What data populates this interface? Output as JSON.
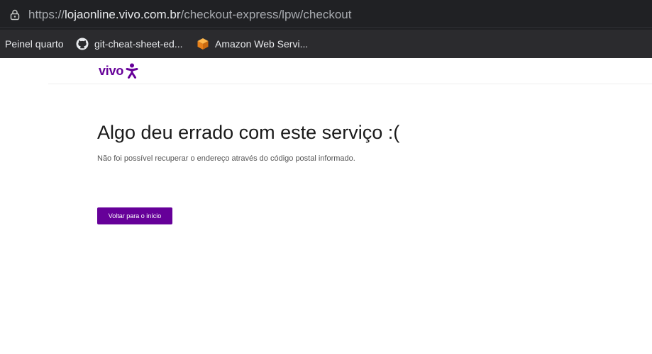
{
  "browser": {
    "url_scheme": "https://",
    "url_host": "lojaonline.vivo.com.br",
    "url_path": "/checkout-express/lpw/checkout",
    "bookmarks": [
      {
        "label": "Peinel quarto",
        "icon": "none"
      },
      {
        "label": "git-cheat-sheet-ed...",
        "icon": "github-icon"
      },
      {
        "label": "Amazon Web Servi...",
        "icon": "aws-cube-icon"
      }
    ]
  },
  "header": {
    "logo_text": "vivo",
    "brand_color": "#660099"
  },
  "main": {
    "title": "Algo deu errado com este serviço :(",
    "message": "Não foi possível recuperar o endereço através do código postal informado.",
    "back_button_label": "Voltar para o início"
  }
}
